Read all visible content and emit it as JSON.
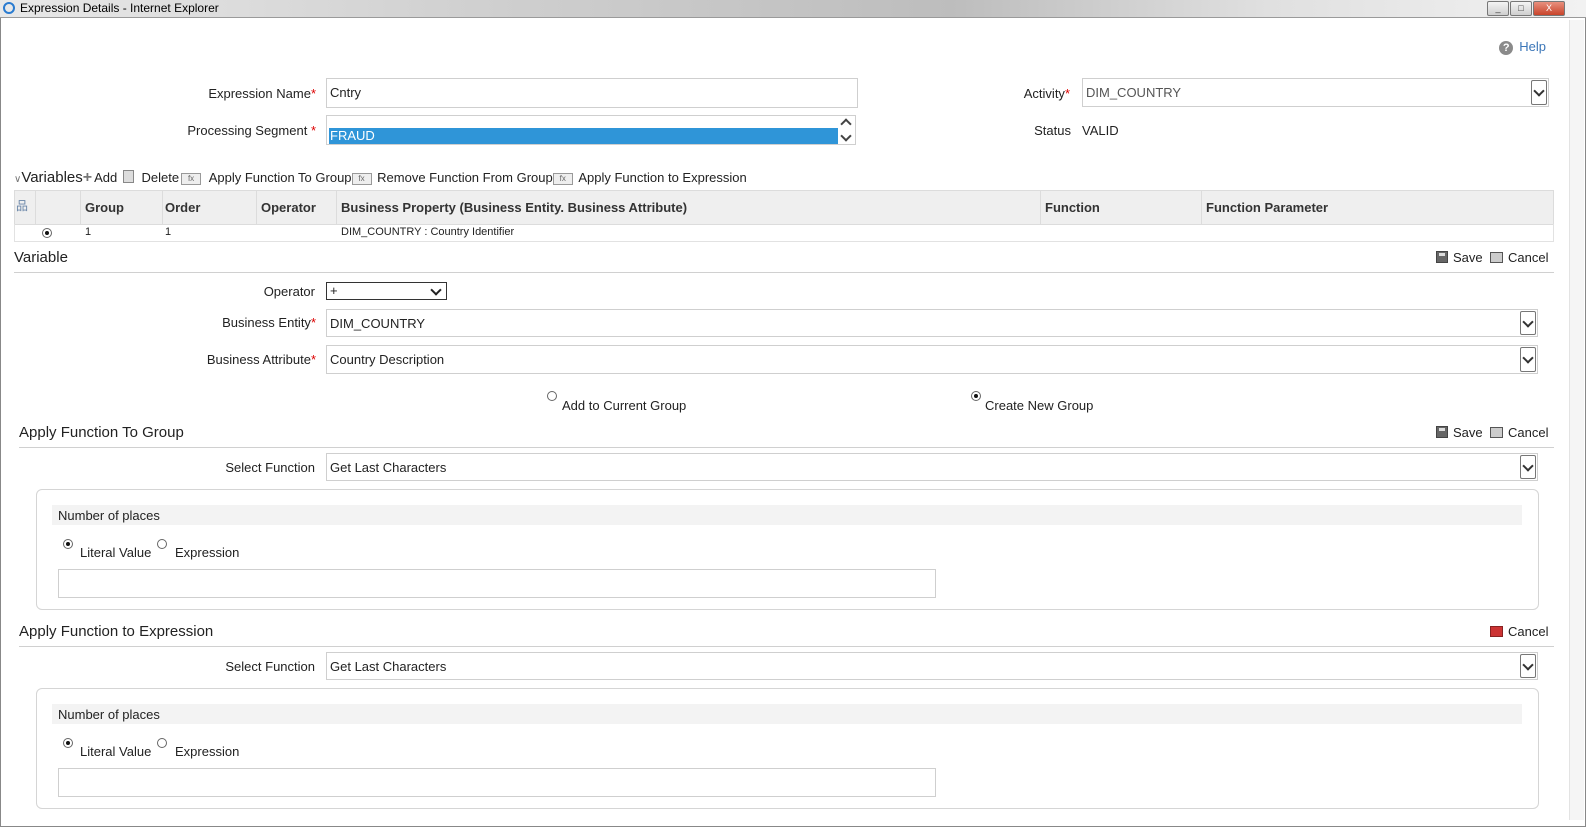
{
  "window": {
    "title": "Expression Details - Internet Explorer",
    "min": "_",
    "max": "□",
    "close": "X"
  },
  "help": "Help",
  "expression": {
    "name_label": "Expression Name",
    "name_value": "Cntry",
    "segment_label": "Processing Segment",
    "segment_value": "FRAUD",
    "activity_label": "Activity",
    "activity_value": "DIM_COUNTRY",
    "status_label": "Status",
    "status_value": "VALID"
  },
  "toolbar": {
    "title": "Variables",
    "add": "Add",
    "delete": "Delete",
    "apply_group": "Apply Function To Group",
    "remove_group": "Remove Function From Group",
    "apply_expr": "Apply Function to Expression"
  },
  "grid": {
    "columns": [
      "Group",
      "Order",
      "Operator",
      "Business Property (Business Entity. Business Attribute)",
      "Function",
      "Function Parameter"
    ],
    "rows": [
      {
        "group": "1",
        "order": "1",
        "operator": "",
        "property": "DIM_COUNTRY : Country Identifier",
        "function": "",
        "param": ""
      }
    ]
  },
  "variable": {
    "title": "Variable",
    "save": "Save",
    "cancel": "Cancel",
    "operator_label": "Operator",
    "operator_value": "+",
    "entity_label": "Business Entity",
    "entity_value": "DIM_COUNTRY",
    "attribute_label": "Business Attribute",
    "attribute_value": "Country Description",
    "opt_current": "Add to Current Group",
    "opt_new": "Create New Group"
  },
  "group_fn": {
    "title": "Apply Function To Group",
    "save": "Save",
    "cancel": "Cancel",
    "select_label": "Select Function",
    "select_value": "Get Last Characters",
    "param_title": "Number of places",
    "literal": "Literal Value",
    "expression": "Expression"
  },
  "expr_fn": {
    "title": "Apply Function to Expression",
    "cancel": "Cancel",
    "select_label": "Select Function",
    "select_value": "Get Last Characters",
    "param_title": "Number of places",
    "literal": "Literal Value",
    "expression": "Expression"
  }
}
